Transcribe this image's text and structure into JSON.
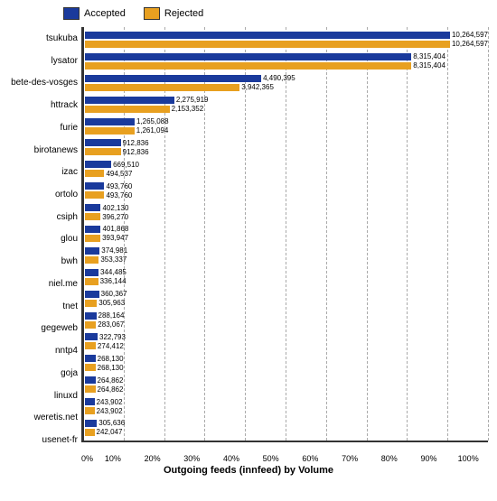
{
  "legend": {
    "accepted_label": "Accepted",
    "rejected_label": "Rejected"
  },
  "chart": {
    "title": "Outgoing feeds (innfeed) by Volume",
    "max_value": 10264597,
    "x_ticks": [
      "0%",
      "10%",
      "20%",
      "30%",
      "40%",
      "50%",
      "60%",
      "70%",
      "80%",
      "90%",
      "100%"
    ],
    "bars": [
      {
        "name": "tsukuba",
        "accepted": 10264597,
        "rejected": 10264597
      },
      {
        "name": "lysator",
        "accepted": 8315404,
        "rejected": 8315404
      },
      {
        "name": "bete-des-vosges",
        "accepted": 4490395,
        "rejected": 3942365
      },
      {
        "name": "httrack",
        "accepted": 2275919,
        "rejected": 2153352
      },
      {
        "name": "furie",
        "accepted": 1265088,
        "rejected": 1261094
      },
      {
        "name": "birotanews",
        "accepted": 912836,
        "rejected": 912836
      },
      {
        "name": "izac",
        "accepted": 669510,
        "rejected": 494537
      },
      {
        "name": "ortolo",
        "accepted": 493760,
        "rejected": 493760
      },
      {
        "name": "csiph",
        "accepted": 402130,
        "rejected": 396270
      },
      {
        "name": "glou",
        "accepted": 401868,
        "rejected": 393947
      },
      {
        "name": "bwh",
        "accepted": 374981,
        "rejected": 353337
      },
      {
        "name": "niel.me",
        "accepted": 344485,
        "rejected": 336144
      },
      {
        "name": "tnet",
        "accepted": 360367,
        "rejected": 305963
      },
      {
        "name": "gegeweb",
        "accepted": 288164,
        "rejected": 283067
      },
      {
        "name": "nntp4",
        "accepted": 322793,
        "rejected": 274412
      },
      {
        "name": "goja",
        "accepted": 268130,
        "rejected": 268130
      },
      {
        "name": "linuxd",
        "accepted": 264862,
        "rejected": 264862
      },
      {
        "name": "weretis.net",
        "accepted": 243902,
        "rejected": 243902
      },
      {
        "name": "usenet-fr",
        "accepted": 305636,
        "rejected": 242047
      }
    ]
  }
}
